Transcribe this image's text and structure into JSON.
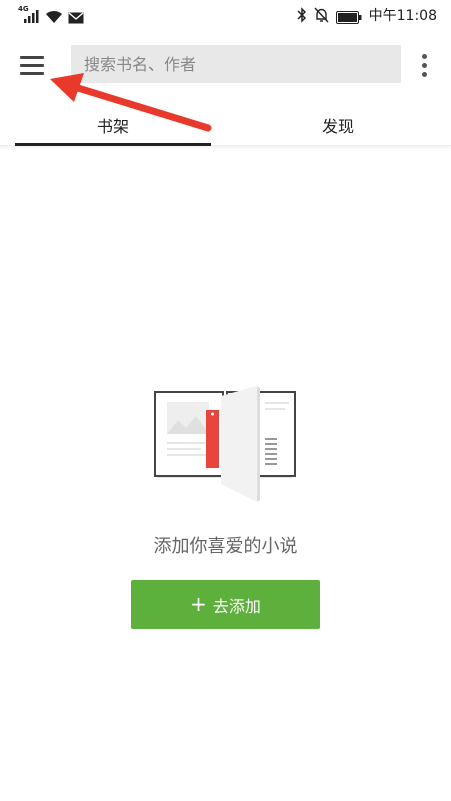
{
  "status_bar": {
    "network_type": "4G",
    "time": "中午11:08"
  },
  "toolbar": {
    "search_placeholder": "搜索书名、作者"
  },
  "tabs": [
    {
      "label": "书架",
      "active": true
    },
    {
      "label": "发现",
      "active": false
    }
  ],
  "empty_state": {
    "message": "添加你喜爱的小说",
    "button_label": "去添加",
    "button_icon": "plus-icon"
  },
  "colors": {
    "accent_green": "#5db03c",
    "annotation_arrow": "#e8392b",
    "bookmark_red": "#e8463d"
  }
}
